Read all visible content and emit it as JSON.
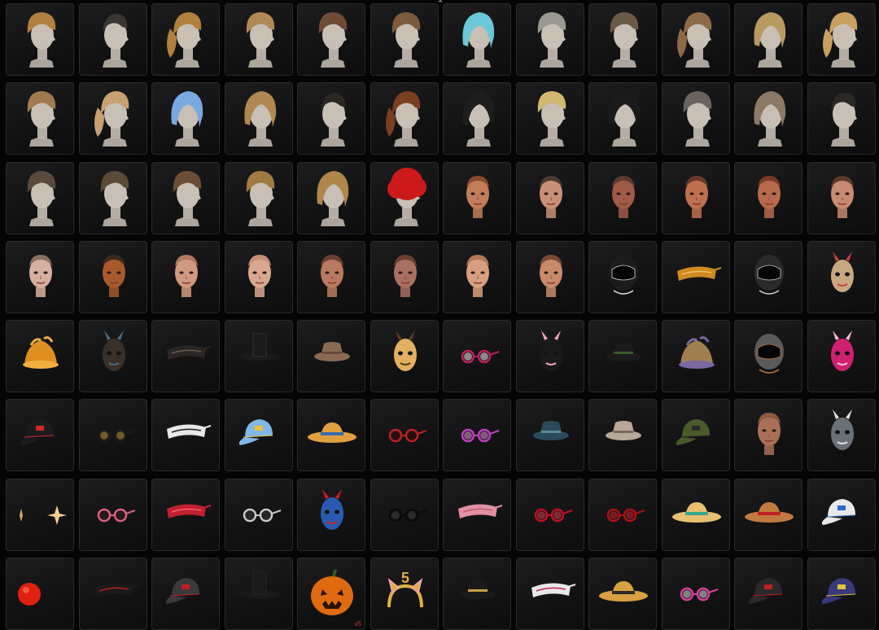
{
  "scroll_up": {
    "glyph": "⌃",
    "icon": "chevron-up-icon"
  },
  "items": [
    {
      "name": "hair-curly-updo",
      "type": "head",
      "hair": "#b08040",
      "skin": "#c8bfb5",
      "style": "short"
    },
    {
      "name": "hair-undercut",
      "type": "head",
      "hair": "#3a3632",
      "skin": "#c8bfb5",
      "style": "buzz"
    },
    {
      "name": "hair-dreadlock-ponytail",
      "type": "head",
      "hair": "#b0803c",
      "skin": "#c8bfb5",
      "style": "long"
    },
    {
      "name": "hair-short-blonde",
      "type": "head",
      "hair": "#b08a55",
      "skin": "#c8bfb5",
      "style": "short"
    },
    {
      "name": "hair-crop-brown",
      "type": "head",
      "hair": "#6e4b36",
      "skin": "#c8bfb5",
      "style": "short"
    },
    {
      "name": "hair-bun-brown",
      "type": "head",
      "hair": "#7b5a3e",
      "skin": "#c8bfb5",
      "style": "short"
    },
    {
      "name": "hair-pastel-bob",
      "type": "head",
      "hair": "#6ac8d8",
      "skin": "#c8bfb5",
      "style": "bob"
    },
    {
      "name": "hair-messy-grey",
      "type": "head",
      "hair": "#9a9890",
      "skin": "#c8bfb5",
      "style": "short"
    },
    {
      "name": "hair-braids",
      "type": "head",
      "hair": "#6a5a48",
      "skin": "#c8bfb5",
      "style": "short"
    },
    {
      "name": "hair-bubble-ponytail",
      "type": "head",
      "hair": "#8c6a48",
      "skin": "#c8bfb5",
      "style": "long"
    },
    {
      "name": "hair-blonde-bob",
      "type": "head",
      "hair": "#b89a60",
      "skin": "#c8bfb5",
      "style": "bob"
    },
    {
      "name": "hair-pink-blonde-ponytail",
      "type": "head",
      "hair": "#c8a060",
      "skin": "#c8bfb5",
      "style": "long"
    },
    {
      "name": "hair-curly-short",
      "type": "head",
      "hair": "#a07a50",
      "skin": "#c8bfb5",
      "style": "short"
    },
    {
      "name": "hair-blonde-ponytail",
      "type": "head",
      "hair": "#c8a072",
      "skin": "#c8bfb5",
      "style": "long"
    },
    {
      "name": "hair-blue-bob",
      "type": "head",
      "hair": "#7aa8e0",
      "skin": "#c8bfb5",
      "style": "bob"
    },
    {
      "name": "hair-long-blonde",
      "type": "head",
      "hair": "#b08850",
      "skin": "#c8bfb5",
      "style": "bob"
    },
    {
      "name": "hair-cornrows",
      "type": "head",
      "hair": "#2a2622",
      "skin": "#c8bfb5",
      "style": "buzz"
    },
    {
      "name": "hair-red-braids",
      "type": "head",
      "hair": "#7a3e22",
      "skin": "#c8bfb5",
      "style": "long"
    },
    {
      "name": "hair-black-long",
      "type": "head",
      "hair": "#1e1c1c",
      "skin": "#c8bfb5",
      "style": "bob"
    },
    {
      "name": "hair-blonde-bun",
      "type": "head",
      "hair": "#d0b870",
      "skin": "#c8bfb5",
      "style": "short"
    },
    {
      "name": "hair-black-bob",
      "type": "head",
      "hair": "#1a1a1c",
      "skin": "#c8bfb5",
      "style": "bob"
    },
    {
      "name": "hair-shag-grey",
      "type": "head",
      "hair": "#6a6460",
      "skin": "#c8bfb5",
      "style": "short"
    },
    {
      "name": "hair-ash-bob",
      "type": "head",
      "hair": "#8a7a66",
      "skin": "#c8bfb5",
      "style": "bob"
    },
    {
      "name": "hair-fade-dark",
      "type": "head",
      "hair": "#2c2824",
      "skin": "#c8bfb5",
      "style": "buzz"
    },
    {
      "name": "hair-slick-short",
      "type": "head",
      "hair": "#5a4a3c",
      "skin": "#c8bfb5",
      "style": "short"
    },
    {
      "name": "hair-top-knot",
      "type": "head",
      "hair": "#5a4a38",
      "skin": "#c8bfb5",
      "style": "short"
    },
    {
      "name": "hair-quiff",
      "type": "head",
      "hair": "#6a4e36",
      "skin": "#c8bfb5",
      "style": "short"
    },
    {
      "name": "hair-bowl",
      "type": "head",
      "hair": "#a07a40",
      "skin": "#c8bfb5",
      "style": "short"
    },
    {
      "name": "hair-shoulder-blonde",
      "type": "head",
      "hair": "#b0874a",
      "skin": "#c8bfb5",
      "style": "bob"
    },
    {
      "name": "hair-red-afro",
      "type": "head",
      "hair": "#cc1a1a",
      "skin": "#c8bfb5",
      "style": "afro"
    },
    {
      "name": "face-female-freckles",
      "type": "face",
      "skin": "#c27e5a",
      "hair": "#8a4a30"
    },
    {
      "name": "face-male-buzz",
      "type": "face",
      "skin": "#c89078",
      "hair": "#4a3a30"
    },
    {
      "name": "face-male-scarred",
      "type": "face",
      "skin": "#a05a48",
      "hair": "#5a3a30"
    },
    {
      "name": "face-female-bindi",
      "type": "face",
      "skin": "#c07050",
      "hair": "#6a3a28"
    },
    {
      "name": "face-female-red",
      "type": "face",
      "skin": "#b86a4e",
      "hair": "#7a3a28"
    },
    {
      "name": "face-female-pale",
      "type": "face",
      "skin": "#c88a70",
      "hair": "#5a3a28"
    },
    {
      "name": "face-female-makeup",
      "type": "face",
      "skin": "#d8b0a0",
      "hair": "#8a7060"
    },
    {
      "name": "face-male-tan",
      "type": "face",
      "skin": "#a85a2c",
      "hair": "#3a2a1c"
    },
    {
      "name": "face-male-bald",
      "type": "face",
      "skin": "#d09a80",
      "hair": "#b07a60"
    },
    {
      "name": "face-female-bald",
      "type": "face",
      "skin": "#d8a890",
      "hair": "#c89078"
    },
    {
      "name": "face-female-dark-makeup",
      "type": "face",
      "skin": "#b87a60",
      "hair": "#6a4030"
    },
    {
      "name": "face-female-pale-2",
      "type": "face",
      "skin": "#a87060",
      "hair": "#6a4030"
    },
    {
      "name": "face-female-fair",
      "type": "face",
      "skin": "#d8a080",
      "hair": "#b07a58"
    },
    {
      "name": "face-female-purple-eyes",
      "type": "face",
      "skin": "#c88a6a",
      "hair": "#7a4a30"
    },
    {
      "name": "helmet-black-visor",
      "type": "helmet",
      "color": "#1c1c1e",
      "accent": "#dddddd"
    },
    {
      "name": "visor-gold-band",
      "type": "band",
      "color": "#d08a22",
      "accent": "#f0c060"
    },
    {
      "name": "mask-ski-black",
      "type": "helmet",
      "color": "#2a2a2c",
      "accent": "#cccccc"
    },
    {
      "name": "mask-scarecrow",
      "type": "mask",
      "color": "#c8a880",
      "accent": "#c84040"
    },
    {
      "name": "hat-chicken",
      "type": "hat",
      "color": "#e09020",
      "accent": "#f0b040"
    },
    {
      "name": "mask-gas-leather",
      "type": "mask",
      "color": "#3a3028",
      "accent": "#4a6a7a"
    },
    {
      "name": "mask-bone-black",
      "type": "band",
      "color": "#2a2624",
      "accent": "#6a5a50"
    },
    {
      "name": "hat-witch",
      "type": "tophat",
      "color": "#1a1a1a",
      "accent": "#3a3a3a"
    },
    {
      "name": "hat-bucket-tan",
      "type": "bucket",
      "color": "#8a6a55",
      "accent": "#6a4a3a"
    },
    {
      "name": "mask-dog",
      "type": "mask",
      "color": "#e0b060",
      "accent": "#5a3a20"
    },
    {
      "name": "glasses-heart",
      "type": "glasses",
      "color": "#c02060",
      "accent": "#ffffff"
    },
    {
      "name": "mask-bear-sleep",
      "type": "mask",
      "color": "#1a1a1a",
      "accent": "#f0a0c0"
    },
    {
      "name": "hat-cat-beanie",
      "type": "bucket",
      "color": "#1a1a1a",
      "accent": "#3a5a2a"
    },
    {
      "name": "hat-straw-wrap",
      "type": "hat",
      "color": "#a08050",
      "accent": "#7a6aa0"
    },
    {
      "name": "mask-gas-grey",
      "type": "helmet",
      "color": "#5a5a5c",
      "accent": "#c07a40"
    },
    {
      "name": "mask-bunny-pink",
      "type": "mask",
      "color": "#d02070",
      "accent": "#f0c0d8"
    },
    {
      "name": "cap-black-red",
      "type": "cap",
      "color": "#1c1c1e",
      "accent": "#d02828"
    },
    {
      "name": "glasses-gold-black",
      "type": "glasses",
      "color": "#1a1a1a",
      "accent": "#c8a040"
    },
    {
      "name": "mask-zebra",
      "type": "band",
      "color": "#e8e8e8",
      "accent": "#1a1a1a"
    },
    {
      "name": "beret-rainbow",
      "type": "cap",
      "color": "#80b8e8",
      "accent": "#f0c040"
    },
    {
      "name": "hat-straw-blue",
      "type": "sunhat",
      "color": "#e0a040",
      "accent": "#3a6ab0"
    },
    {
      "name": "glasses-red-round",
      "type": "glasses",
      "color": "#c02020",
      "accent": "#3a0a0a"
    },
    {
      "name": "glasses-heart-purple",
      "type": "glasses",
      "color": "#c040c0",
      "accent": "#f0a0f0"
    },
    {
      "name": "hat-fedora-blue",
      "type": "bucket",
      "color": "#2a4a5a",
      "accent": "#5a8a9a"
    },
    {
      "name": "hat-plaid",
      "type": "bucket",
      "color": "#b8a898",
      "accent": "#7a6a5a"
    },
    {
      "name": "cap-army-headset",
      "type": "cap",
      "color": "#4a5a2a",
      "accent": "#2a2a2a"
    },
    {
      "name": "mask-stocking",
      "type": "face",
      "skin": "#a87058",
      "hair": "#8a5a40"
    },
    {
      "name": "mask-shark",
      "type": "mask",
      "color": "#6a7078",
      "accent": "#e0e0e0"
    },
    {
      "name": "earrings-star",
      "type": "star",
      "color": "#d8b060",
      "accent": "#f0d090"
    },
    {
      "name": "glasses-pink-frame",
      "type": "glasses",
      "color": "#e06080",
      "accent": "#3a2020"
    },
    {
      "name": "eyepatch-red-sequin",
      "type": "band",
      "color": "#c02030",
      "accent": "#ff6070"
    },
    {
      "name": "glasses-shutter",
      "type": "glasses",
      "color": "#c8c8c8",
      "accent": "#3a3a3a"
    },
    {
      "name": "mask-oni-blue",
      "type": "mask",
      "color": "#2a5ab0",
      "accent": "#d02020"
    },
    {
      "name": "glasses-black-shades",
      "type": "glasses",
      "color": "#0a0a0a",
      "accent": "#444444"
    },
    {
      "name": "mask-sleep-pink",
      "type": "band",
      "color": "#e090a0",
      "accent": "#c06070"
    },
    {
      "name": "glasses-cateye-red",
      "type": "glasses",
      "color": "#c01020",
      "accent": "#f04050"
    },
    {
      "name": "glasses-red-large",
      "type": "glasses",
      "color": "#b01018",
      "accent": "#e02030"
    },
    {
      "name": "hat-straw-green",
      "type": "sunhat",
      "color": "#e8c070",
      "accent": "#3aa890"
    },
    {
      "name": "hat-straw-orange",
      "type": "sunhat",
      "color": "#c07a40",
      "accent": "#c02020"
    },
    {
      "name": "cap-blue-white",
      "type": "cap",
      "color": "#e8e8e8",
      "accent": "#2a6ad0"
    },
    {
      "name": "clown-nose",
      "type": "ball",
      "color": "#e02010",
      "accent": "#ff8060"
    },
    {
      "name": "mask-black-quilted",
      "type": "band",
      "color": "#1a1a1a",
      "accent": "#c02020"
    },
    {
      "name": "cap-grey-red",
      "type": "cap",
      "color": "#3a3a3c",
      "accent": "#c02020"
    },
    {
      "name": "hat-wide-black",
      "type": "tophat",
      "color": "#1a1a1a",
      "accent": "#2a2a2a"
    },
    {
      "name": "pumpkin-head",
      "type": "pumpkin",
      "color": "#e06a10",
      "accent": "#2a1000",
      "badge": "x5"
    },
    {
      "name": "headband-cat-ears",
      "type": "cat",
      "color": "#e0b040",
      "accent": "#f0a0c0",
      "label": "5"
    },
    {
      "name": "hat-bucket-black",
      "type": "bucket",
      "color": "#1a1a1a",
      "accent": "#c8a040"
    },
    {
      "name": "mask-graffiti",
      "type": "band",
      "color": "#e8e8e8",
      "accent": "#c02060"
    },
    {
      "name": "hat-straw-yellow",
      "type": "sunhat",
      "color": "#d8a040",
      "accent": "#2a2a2a"
    },
    {
      "name": "goggles-pink",
      "type": "glasses",
      "color": "#e040a0",
      "accent": "#f0f0f0"
    },
    {
      "name": "cap-black-headset",
      "type": "cap",
      "color": "#2a2a2c",
      "accent": "#c02020"
    },
    {
      "name": "cap-navy-headset",
      "type": "cap",
      "color": "#3a3a7a",
      "accent": "#e0c040"
    }
  ]
}
